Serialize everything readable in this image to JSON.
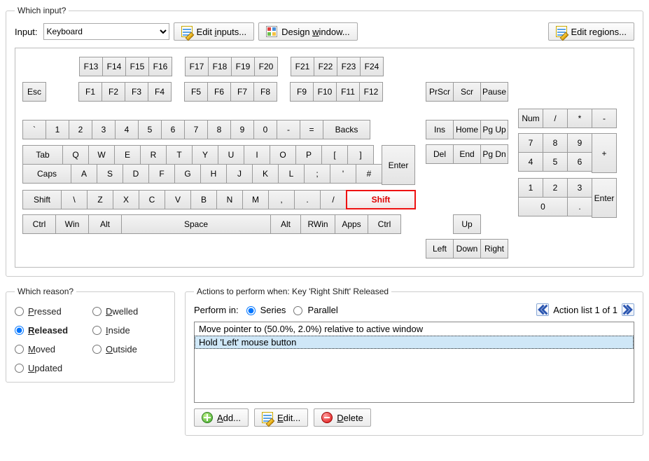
{
  "top": {
    "legend": "Which input?",
    "input_label": "Input:",
    "input_value": "Keyboard",
    "edit_inputs": "Edit inputs...",
    "design_window": "Design window...",
    "edit_regions": "Edit regions..."
  },
  "keyboard": {
    "frow_upper": [
      "F13",
      "F14",
      "F15",
      "F16",
      "F17",
      "F18",
      "F19",
      "F20",
      "F21",
      "F22",
      "F23",
      "F24"
    ],
    "frow_lower_left": "Esc",
    "frow_lower": [
      "F1",
      "F2",
      "F3",
      "F4",
      "F5",
      "F6",
      "F7",
      "F8",
      "F9",
      "F10",
      "F11",
      "F12"
    ],
    "sys": [
      "PrScr",
      "Scr",
      "Pause"
    ],
    "row1": [
      "`",
      "1",
      "2",
      "3",
      "4",
      "5",
      "6",
      "7",
      "8",
      "9",
      "0",
      "-",
      "=",
      "Backs"
    ],
    "row2": [
      "Tab",
      "Q",
      "W",
      "E",
      "R",
      "T",
      "Y",
      "U",
      "I",
      "O",
      "P",
      "[",
      "]"
    ],
    "row2_enter": "Enter",
    "row3": [
      "Caps",
      "A",
      "S",
      "D",
      "F",
      "G",
      "H",
      "J",
      "K",
      "L",
      ";",
      "'",
      "#"
    ],
    "row4_left": [
      "Shift",
      "\\",
      "Z",
      "X",
      "C",
      "V",
      "B",
      "N",
      "M",
      ",",
      ".",
      "/"
    ],
    "row4_right": "Shift",
    "row5": [
      "Ctrl",
      "Win",
      "Alt",
      "Space",
      "Alt",
      "RWin",
      "Apps",
      "Ctrl"
    ],
    "nav1": [
      "Ins",
      "Home",
      "Pg Up"
    ],
    "nav2": [
      "Del",
      "End",
      "Pg Dn"
    ],
    "arrow_up": "Up",
    "arrows": [
      "Left",
      "Down",
      "Right"
    ],
    "num1": [
      "Num",
      "/",
      "*",
      "-"
    ],
    "num2": [
      "7",
      "8",
      "9"
    ],
    "num_plus": "+",
    "num3": [
      "4",
      "5",
      "6"
    ],
    "num4": [
      "1",
      "2",
      "3"
    ],
    "num_enter": "Enter",
    "num5_zero": "0",
    "num5_dot": "."
  },
  "reason": {
    "legend": "Which reason?",
    "options": [
      "Pressed",
      "Dwelled",
      "Released",
      "Inside",
      "Moved",
      "Outside",
      "Updated"
    ],
    "selected": "Released"
  },
  "actions": {
    "legend": "Actions to perform when: Key 'Right Shift' Released",
    "perform_label": "Perform in:",
    "series": "Series",
    "parallel": "Parallel",
    "perform_selected": "Series",
    "list_text": "Action list 1 of 1",
    "items": [
      "Move pointer to (50.0%, 2.0%) relative to active window",
      "Hold 'Left' mouse button"
    ],
    "selected_index": 1,
    "add": "Add...",
    "edit": "Edit...",
    "del": "Delete"
  }
}
